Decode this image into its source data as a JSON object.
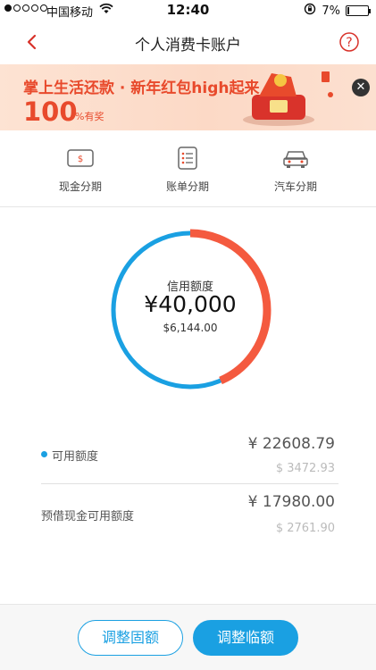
{
  "status_bar": {
    "carrier": "中国移动",
    "time": "12:40",
    "battery": "7%"
  },
  "nav": {
    "title": "个人消费卡账户",
    "help_icon": "question-circle-icon",
    "back_icon": "chevron-left-icon"
  },
  "banner": {
    "title": "掌上生活还款 · 新年红包high起来",
    "amount": "100",
    "amount_unit": "%有奖"
  },
  "actions": [
    {
      "label": "现金分期",
      "icon": "cash-icon"
    },
    {
      "label": "账单分期",
      "icon": "bill-list-icon"
    },
    {
      "label": "汽车分期",
      "icon": "car-icon"
    }
  ],
  "credit": {
    "label": "信用额度",
    "amount": "¥40,000",
    "usd": "$6,144.00",
    "available_fraction": 0.565
  },
  "available": {
    "label": "可用额度",
    "cny": "¥ 22608.79",
    "usd": "$ 3472.93"
  },
  "cash_advance": {
    "label": "预借现金可用额度",
    "cny": "¥ 17980.00",
    "usd": "$ 2761.90"
  },
  "buttons": {
    "fixed": "调整固额",
    "temporary": "调整临额"
  },
  "colors": {
    "accent_blue": "#1aa0e2",
    "used_red": "#f45a3f",
    "banner_red": "#e84a2c"
  }
}
